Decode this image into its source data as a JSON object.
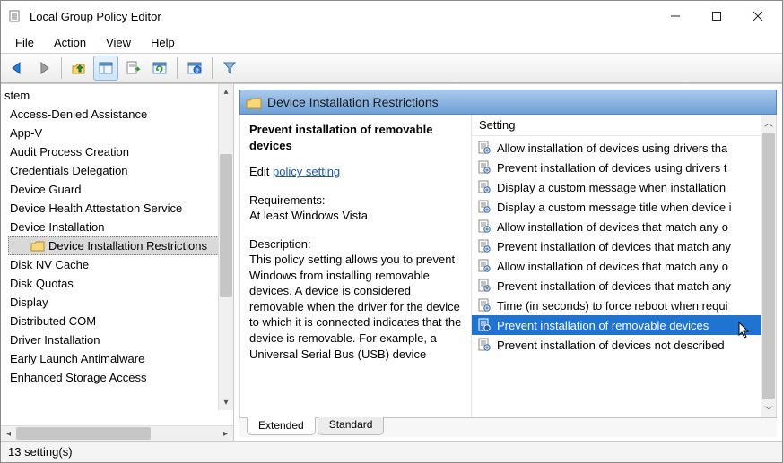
{
  "window": {
    "title": "Local Group Policy Editor"
  },
  "menu": {
    "items": [
      "File",
      "Action",
      "View",
      "Help"
    ]
  },
  "toolbar": {
    "buttons": [
      {
        "name": "back-arrow-icon"
      },
      {
        "name": "forward-arrow-icon"
      },
      {
        "name": "up-folder-icon"
      },
      {
        "name": "show-hide-tree-icon"
      },
      {
        "name": "export-list-icon"
      },
      {
        "name": "refresh-icon"
      },
      {
        "name": "help-icon"
      },
      {
        "name": "filter-icon"
      }
    ]
  },
  "tree": {
    "partial_top": "stem",
    "items": [
      "Access-Denied Assistance",
      "App-V",
      "Audit Process Creation",
      "Credentials Delegation",
      "Device Guard",
      "Device Health Attestation Service",
      "Device Installation",
      "Device Installation Restrictions",
      "Disk NV Cache",
      "Disk Quotas",
      "Display",
      "Distributed COM",
      "Driver Installation",
      "Early Launch Antimalware",
      "Enhanced Storage Access"
    ],
    "selected_index": 7
  },
  "category": {
    "title": "Device Installation Restrictions"
  },
  "details": {
    "policy_title": "Prevent installation of removable devices",
    "edit_prefix": "Edit ",
    "edit_link": "policy setting",
    "requirements_label": "Requirements:",
    "requirements_value": "At least Windows Vista",
    "description_label": "Description:",
    "description_text": "This policy setting allows you to prevent Windows from installing removable devices. A device is considered removable when the driver for the device to which it is connected indicates that the device is removable. For example, a Universal Serial Bus (USB) device"
  },
  "settings": {
    "header": "Setting",
    "items": [
      "Allow installation of devices using drivers tha",
      "Prevent installation of devices using drivers t",
      "Display a custom message when installation",
      "Display a custom message title when device i",
      "Allow installation of devices that match any o",
      "Prevent installation of devices that match any",
      "Allow installation of devices that match any o",
      "Prevent installation of devices that match any",
      "Time (in seconds) to force reboot when requi",
      "Prevent installation of removable devices",
      "Prevent installation of devices not described"
    ],
    "selected_index": 9
  },
  "tabs": {
    "items": [
      "Extended",
      "Standard"
    ],
    "active_index": 0
  },
  "status": {
    "text": "13 setting(s)"
  }
}
